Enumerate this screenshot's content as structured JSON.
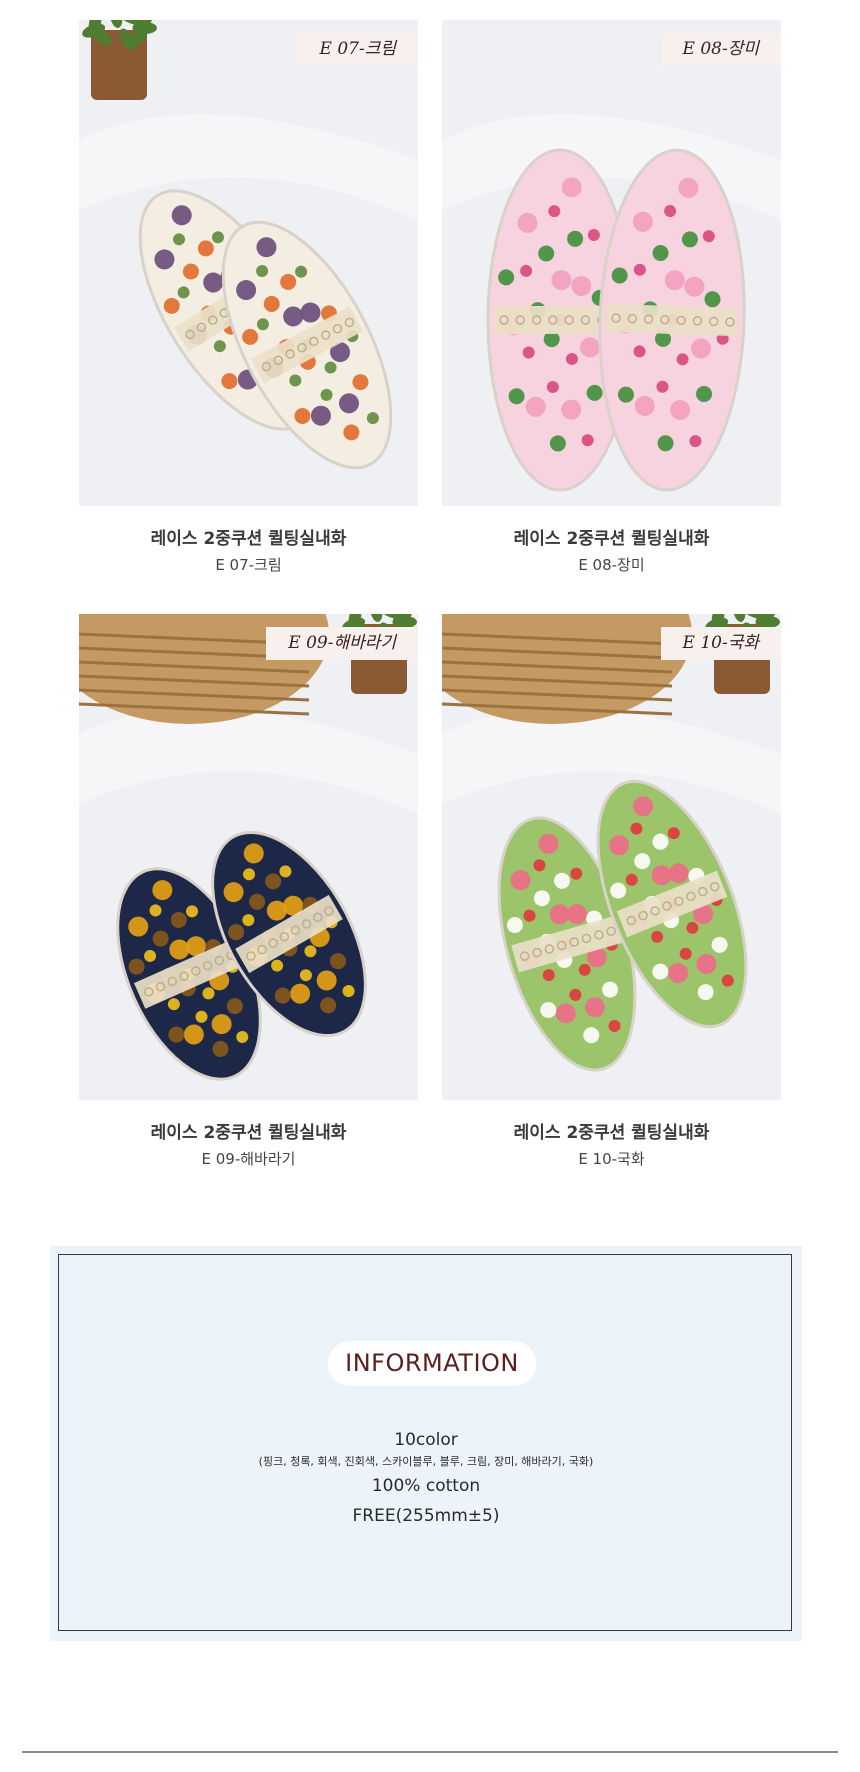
{
  "products": [
    {
      "tag": "E 07-크림",
      "name": "레이스 2중쿠션 퀼팅실내화",
      "code": "E 07-크림",
      "colors": {
        "base": "#f4eee2",
        "accent1": "#5f8a3e",
        "accent2": "#e06a2a",
        "accent3": "#6a4a7a"
      }
    },
    {
      "tag": "E 08-장미",
      "name": "레이스 2중쿠션 퀼팅실내화",
      "code": "E 08-장미",
      "colors": {
        "base": "#f6d3df",
        "accent1": "#d9477d",
        "accent2": "#3f8f3a",
        "accent3": "#f29fbd"
      }
    },
    {
      "tag": "E 09-해바라기",
      "name": "레이스 2중쿠션 퀼팅실내화",
      "code": "E 09-해바라기",
      "colors": {
        "base": "#1d2748",
        "accent1": "#f3c21b",
        "accent2": "#8a5a1a",
        "accent3": "#e9a313"
      }
    },
    {
      "tag": "E 10-국화",
      "name": "레이스 2중쿠션 퀼팅실내화",
      "code": "E 10-국화",
      "colors": {
        "base": "#9cc46a",
        "accent1": "#e0383d",
        "accent2": "#ffffff",
        "accent3": "#f06a8a"
      }
    }
  ],
  "info": {
    "heading": "INFORMATION",
    "color_count": "10color",
    "color_list": "(핑크, 청록, 회색, 진회색, 스카이블루, 블루, 크림, 장미, 해바라기, 국화)",
    "material": "100% cotton",
    "size": "FREE(255mm±5)"
  }
}
